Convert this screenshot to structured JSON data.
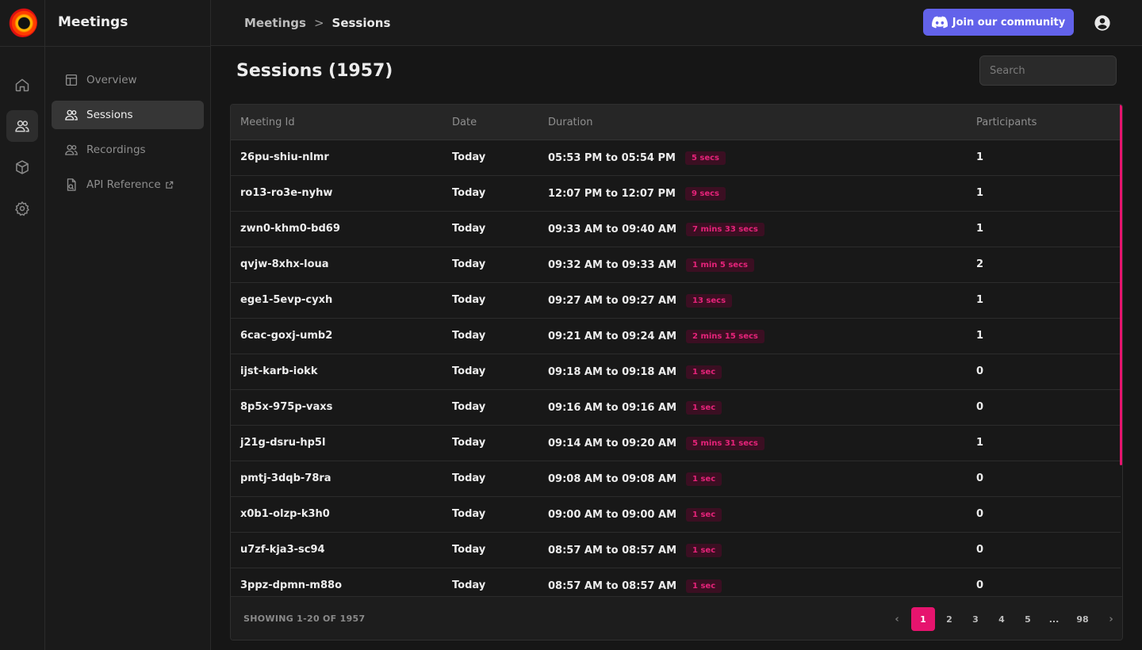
{
  "app": {
    "title": "Meetings"
  },
  "header": {
    "breadcrumb": [
      "Meetings",
      "Sessions"
    ],
    "breadcrumb_separator": ">",
    "join_button": "Join our community",
    "accent": "#6262ea"
  },
  "sidebar": {
    "items": [
      {
        "label": "Overview",
        "icon": "layout-icon",
        "active": false
      },
      {
        "label": "Sessions",
        "icon": "users-icon",
        "active": true
      },
      {
        "label": "Recordings",
        "icon": "users-icon",
        "active": false
      },
      {
        "label": "API Reference",
        "icon": "doc-icon",
        "active": false,
        "external": true
      }
    ]
  },
  "rail": {
    "icons": [
      "home-icon",
      "users-icon",
      "cube-icon",
      "settings-icon"
    ],
    "active": "users-icon"
  },
  "page": {
    "title": "Sessions (1957)",
    "search_placeholder": "Search"
  },
  "table": {
    "columns": [
      "Meeting Id",
      "Date",
      "Duration",
      "Participants"
    ],
    "rows": [
      {
        "id": "26pu-shiu-nlmr",
        "date": "Today",
        "time": "05:53 PM to 05:54 PM",
        "dur": "5 secs",
        "participants": "1"
      },
      {
        "id": "ro13-ro3e-nyhw",
        "date": "Today",
        "time": "12:07 PM to 12:07 PM",
        "dur": "9 secs",
        "participants": "1"
      },
      {
        "id": "zwn0-khm0-bd69",
        "date": "Today",
        "time": "09:33 AM to 09:40 AM",
        "dur": "7 mins 33 secs",
        "participants": "1"
      },
      {
        "id": "qvjw-8xhx-loua",
        "date": "Today",
        "time": "09:32 AM to 09:33 AM",
        "dur": "1 min 5 secs",
        "participants": "2"
      },
      {
        "id": "ege1-5evp-cyxh",
        "date": "Today",
        "time": "09:27 AM to 09:27 AM",
        "dur": "13 secs",
        "participants": "1"
      },
      {
        "id": "6cac-goxj-umb2",
        "date": "Today",
        "time": "09:21 AM to 09:24 AM",
        "dur": "2 mins 15 secs",
        "participants": "1"
      },
      {
        "id": "ijst-karb-iokk",
        "date": "Today",
        "time": "09:18 AM to 09:18 AM",
        "dur": "1 sec",
        "participants": "0"
      },
      {
        "id": "8p5x-975p-vaxs",
        "date": "Today",
        "time": "09:16 AM to 09:16 AM",
        "dur": "1 sec",
        "participants": "0"
      },
      {
        "id": "j21g-dsru-hp5l",
        "date": "Today",
        "time": "09:14 AM to 09:20 AM",
        "dur": "5 mins 31 secs",
        "participants": "1"
      },
      {
        "id": "pmtj-3dqb-78ra",
        "date": "Today",
        "time": "09:08 AM to 09:08 AM",
        "dur": "1 sec",
        "participants": "0"
      },
      {
        "id": "x0b1-olzp-k3h0",
        "date": "Today",
        "time": "09:00 AM to 09:00 AM",
        "dur": "1 sec",
        "participants": "0"
      },
      {
        "id": "u7zf-kja3-sc94",
        "date": "Today",
        "time": "08:57 AM to 08:57 AM",
        "dur": "1 sec",
        "participants": "0"
      },
      {
        "id": "3ppz-dpmn-m88o",
        "date": "Today",
        "time": "08:57 AM to 08:57 AM",
        "dur": "1 sec",
        "participants": "0"
      }
    ]
  },
  "footer": {
    "showing": "SHOWING 1-20 OF 1957",
    "pages": [
      "1",
      "2",
      "3",
      "4",
      "5",
      "...",
      "98"
    ],
    "current_page": "1",
    "prev": "‹",
    "next": "›",
    "accent": "#e6146e"
  }
}
